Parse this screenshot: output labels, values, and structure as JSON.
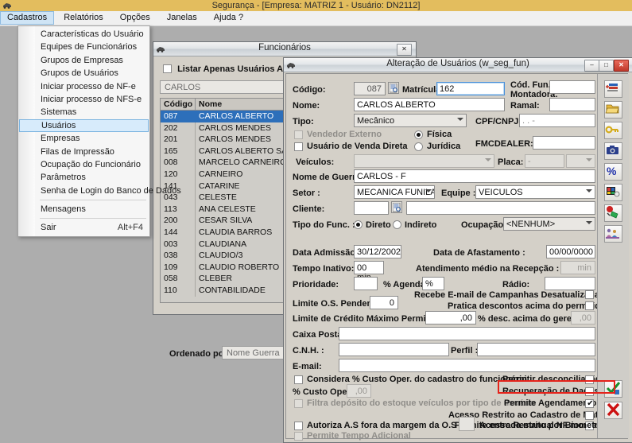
{
  "app": {
    "title": "Segurança - [Empresa: MATRIZ 1 - Usuário: DN2112]",
    "titlebar_color": "#e3bd5e"
  },
  "menubar": {
    "items": [
      {
        "label": "Cadastros",
        "active": true
      },
      {
        "label": "Relatórios",
        "active": false
      },
      {
        "label": "Opções",
        "active": false
      },
      {
        "label": "Janelas",
        "active": false
      },
      {
        "label": "Ajuda ?",
        "active": false
      }
    ]
  },
  "dropdown": {
    "items": [
      {
        "label": "Características do Usuário",
        "selected": false,
        "accel": "",
        "sep_after": false
      },
      {
        "label": "Equipes de Funcionários",
        "selected": false,
        "accel": "",
        "sep_after": false
      },
      {
        "label": "Grupos de Empresas",
        "selected": false,
        "accel": "",
        "sep_after": false
      },
      {
        "label": "Grupos de Usuários",
        "selected": false,
        "accel": "",
        "sep_after": false
      },
      {
        "label": "Iniciar processo de NF-e",
        "selected": false,
        "accel": "",
        "sep_after": false
      },
      {
        "label": "Iniciar processo de NFS-e",
        "selected": false,
        "accel": "",
        "sep_after": false
      },
      {
        "label": "Sistemas",
        "selected": false,
        "accel": "",
        "sep_after": false
      },
      {
        "label": "Usuários",
        "selected": true,
        "accel": "",
        "sep_after": false
      },
      {
        "label": "Empresas",
        "selected": false,
        "accel": "",
        "sep_after": false
      },
      {
        "label": "Filas de Impressão",
        "selected": false,
        "accel": "",
        "sep_after": false
      },
      {
        "label": "Ocupação do Funcionário",
        "selected": false,
        "accel": "",
        "sep_after": false
      },
      {
        "label": "Parâmetros",
        "selected": false,
        "accel": "",
        "sep_after": false
      },
      {
        "label": "Senha de Login do Banco de Dados",
        "selected": false,
        "accel": "",
        "sep_after": true
      },
      {
        "label": "Mensagens",
        "selected": false,
        "accel": "",
        "sep_after": true
      },
      {
        "label": "Sair",
        "selected": false,
        "accel": "Alt+F4",
        "sep_after": false
      }
    ]
  },
  "funcionarios_window": {
    "title": "Funcionários",
    "close_label": "✕",
    "listar_ativos_label": "Listar Apenas Usuários Ativos",
    "listar_ativos_checked": false,
    "filter_value": "CARLOS",
    "columns": [
      "Código",
      "Nome"
    ],
    "rows": [
      {
        "codigo": "087",
        "nome": "CARLOS ALBERTO",
        "selected": true
      },
      {
        "codigo": "202",
        "nome": "CARLOS MENDES",
        "selected": false
      },
      {
        "codigo": "201",
        "nome": "CARLOS MENDES",
        "selected": false
      },
      {
        "codigo": "165",
        "nome": "CARLOS ALBERTO SANT",
        "selected": false
      },
      {
        "codigo": "008",
        "nome": "MARCELO CARNEIRO",
        "selected": false
      },
      {
        "codigo": "120",
        "nome": "CARNEIRO",
        "selected": false
      },
      {
        "codigo": "141",
        "nome": "CATARINE",
        "selected": false
      },
      {
        "codigo": "043",
        "nome": "CELESTE",
        "selected": false
      },
      {
        "codigo": "113",
        "nome": "ANA CELESTE",
        "selected": false
      },
      {
        "codigo": "200",
        "nome": "CESAR SILVA",
        "selected": false
      },
      {
        "codigo": "144",
        "nome": "CLAUDIA BARROS",
        "selected": false
      },
      {
        "codigo": "003",
        "nome": "CLAUDIANA",
        "selected": false
      },
      {
        "codigo": "038",
        "nome": "CLAUDIO/3",
        "selected": false
      },
      {
        "codigo": "109",
        "nome": "CLAUDIO ROBERTO",
        "selected": false
      },
      {
        "codigo": "058",
        "nome": "CLEBER",
        "selected": false
      },
      {
        "codigo": "110",
        "nome": "CONTABILIDADE",
        "selected": false
      }
    ],
    "ordenado_label": "Ordenado por :",
    "ordenado_value": "Nome Guerra"
  },
  "alteracao_window": {
    "title": "Alteração de Usuários (w_seg_fun)",
    "minimize_label": "–",
    "maximize_label": "□",
    "close_label": "✕",
    "fields": {
      "codigo_label": "Código:",
      "codigo_value": "087",
      "matricula_label": "Matrícula:",
      "matricula_value": "162",
      "cod_fun_montadora_label_l1": "Cód. Fun.",
      "cod_fun_montadora_label_l2": "Montadora:",
      "cod_fun_montadora_value": "",
      "nome_label": "Nome:",
      "nome_value": "CARLOS ALBERTO",
      "ramal_label": "Ramal:",
      "ramal_value": "",
      "tipo_label": "Tipo:",
      "tipo_value": "Mecânico",
      "cpf_cnpj_label": "CPF/CNPJ:",
      "cpf_cnpj_value": ".   .     -",
      "vendedor_externo_label": "Vendedor Externo",
      "vendedor_externo_checked": false,
      "usuario_venda_direta_label": "Usuário de Venda Direta",
      "usuario_venda_direta_checked": false,
      "fisica_label": "Física",
      "juridica_label": "Jurídica",
      "pessoa_selected": "Física",
      "fmcdealer_label": "FMCDEALER:",
      "fmcdealer_value": "",
      "veiculos_label": "Veículos:",
      "veiculos_value": "",
      "placa_label": "Placa:",
      "placa_value": "-",
      "nome_guerra_label": "Nome de Guerra:",
      "nome_guerra_value": "CARLOS - F",
      "setor_label": "Setor :",
      "setor_value": "MECANICA FUNILARI",
      "equipe_label": "Equipe :",
      "equipe_value": "VEICULOS",
      "cliente_label": "Cliente:",
      "cliente_code_value": "",
      "cliente_name_value": "",
      "tipo_func_label": "Tipo do Func. :",
      "direto_label": "Direto",
      "indireto_label": "Indireto",
      "tipo_func_selected": "Direto",
      "ocupacao_label": "Ocupação :",
      "ocupacao_value": "<NENHUM>",
      "data_admissao_label": "Data Admissão :",
      "data_admissao_value": "30/12/2002",
      "data_afastamento_label": "Data de Afastamento :",
      "data_afastamento_value": "00/00/0000",
      "tempo_inativo_label": "Tempo Inativo:",
      "tempo_inativo_value": "00 min",
      "atendimento_medio_label": "Atendimento médio na Recepção :",
      "atendimento_medio_value": "min",
      "prioridade_label": "Prioridade:",
      "prioridade_value": "",
      "perc_agenda_label": "% Agenda:",
      "perc_agenda_value": "%",
      "radio_label": "Rádio:",
      "radio_value": "",
      "limite_os_label": "Limite O.S. Pendente:",
      "limite_os_value": "0",
      "recebe_email_label": "Recebe E-mail de Campanhas Desatualizadas",
      "recebe_email_checked": false,
      "pratica_descontos_label": "Pratica descontos acima do permitido",
      "pratica_descontos_checked": false,
      "limite_credito_label": "Limite de Crédito Máximo Permitido :",
      "limite_credito_value": ",00",
      "perc_desc_gerente_label": "% desc. acima do gerente:",
      "perc_desc_gerente_value": ",00",
      "caixa_postal_label": "Caixa Postal:",
      "caixa_postal_value": "",
      "cnh_label": "C.N.H. :",
      "cnh_value": "",
      "perfil_label": "Perfil :",
      "perfil_value": "",
      "email_label": "E-mail:",
      "email_value": "",
      "considera_custo_label": "Considera % Custo Oper. do cadastro do funcionário",
      "considera_custo_checked": false,
      "perc_custo_oper_label": "% Custo Oper.",
      "perc_custo_oper_value": ",00",
      "filtra_deposito_label": "Filtra depósito do estoque veículos por tipo de usuário",
      "filtra_deposito_checked": false,
      "autoriza_as_label": "Autoriza A.S fora da margem da O.S",
      "autoriza_as_checked": false,
      "permite_tempo_adicional_label": "Permite Tempo Adicional",
      "permite_tempo_adicional_checked": false,
      "permitir_desconciliacao_label": "Permitir desconciliação",
      "permitir_desconciliacao_checked": false,
      "recuperacao_dados_label": "Recuperação de Dados",
      "recuperacao_dados_checked": false,
      "permite_agendamento_label": "Permite Agendamento",
      "permite_agendamento_checked": true,
      "acesso_restrito_material_label": "Acesso Restrito ao Cadastro de Material",
      "acesso_restrito_material_checked": false,
      "permite_entrada_nf_label": "Permite entrada manual NF montadora",
      "permite_entrada_nf_checked": false,
      "acesso_biometria_label": "Acesso Restrito por Biometria",
      "acesso_biometria_checked": false
    },
    "side_toolbar": [
      {
        "icon": "add-record-icon"
      },
      {
        "icon": "open-folder-icon"
      },
      {
        "icon": "key-icon"
      },
      {
        "icon": "camera-icon"
      },
      {
        "icon": "percent-icon"
      },
      {
        "icon": "palette-icon"
      },
      {
        "icon": "paint-icon"
      },
      {
        "icon": "people-icon"
      }
    ],
    "action_buttons": [
      {
        "icon": "confirm-check-icon",
        "glyph": "✔",
        "color": "#1f9a33"
      },
      {
        "icon": "cancel-x-icon",
        "glyph": "✖",
        "color": "#cc1111"
      }
    ],
    "highlight_color": "#e5231b"
  }
}
